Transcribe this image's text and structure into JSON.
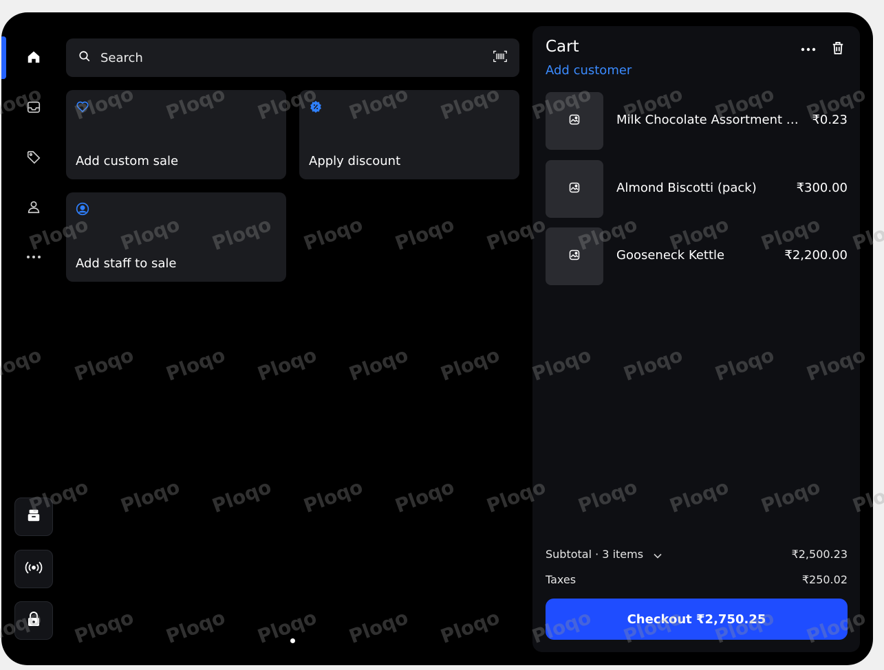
{
  "sidebar": {
    "nav_items": [
      {
        "icon": "home-icon",
        "active": true
      },
      {
        "icon": "inbox-icon",
        "active": false
      },
      {
        "icon": "tag-icon",
        "active": false
      },
      {
        "icon": "user-icon",
        "active": false
      },
      {
        "icon": "more-horizontal-icon",
        "active": false
      }
    ],
    "bottom_buttons": [
      {
        "icon": "register-icon"
      },
      {
        "icon": "broadcast-icon"
      },
      {
        "icon": "lock-icon"
      }
    ]
  },
  "search": {
    "label": "Search",
    "scan_icon": "barcode-scan-icon"
  },
  "tiles": [
    {
      "label": "Add custom sale",
      "icon": "heart-outline-icon"
    },
    {
      "label": "Apply discount",
      "icon": "discount-badge-icon"
    },
    {
      "label": "Add staff to sale",
      "icon": "user-circle-icon"
    }
  ],
  "cart": {
    "title": "Cart",
    "add_customer": "Add customer",
    "items": [
      {
        "name": "Milk Chocolate Assortment (box)",
        "price": "₹0.23"
      },
      {
        "name": "Almond Biscotti (pack)",
        "price": "₹300.00"
      },
      {
        "name": "Gooseneck Kettle",
        "price": "₹2,200.00"
      }
    ],
    "subtotal_label": "Subtotal · 3 items",
    "subtotal_value": "₹2,500.23",
    "taxes_label": "Taxes",
    "taxes_value": "₹250.02",
    "checkout_label": "Checkout ₹2,750.25"
  },
  "watermark": "Ploqo",
  "colors": {
    "accent": "#1f4dff",
    "link": "#3b8bff",
    "panel": "#1b1c20",
    "cart_bg": "#0e0f13"
  }
}
